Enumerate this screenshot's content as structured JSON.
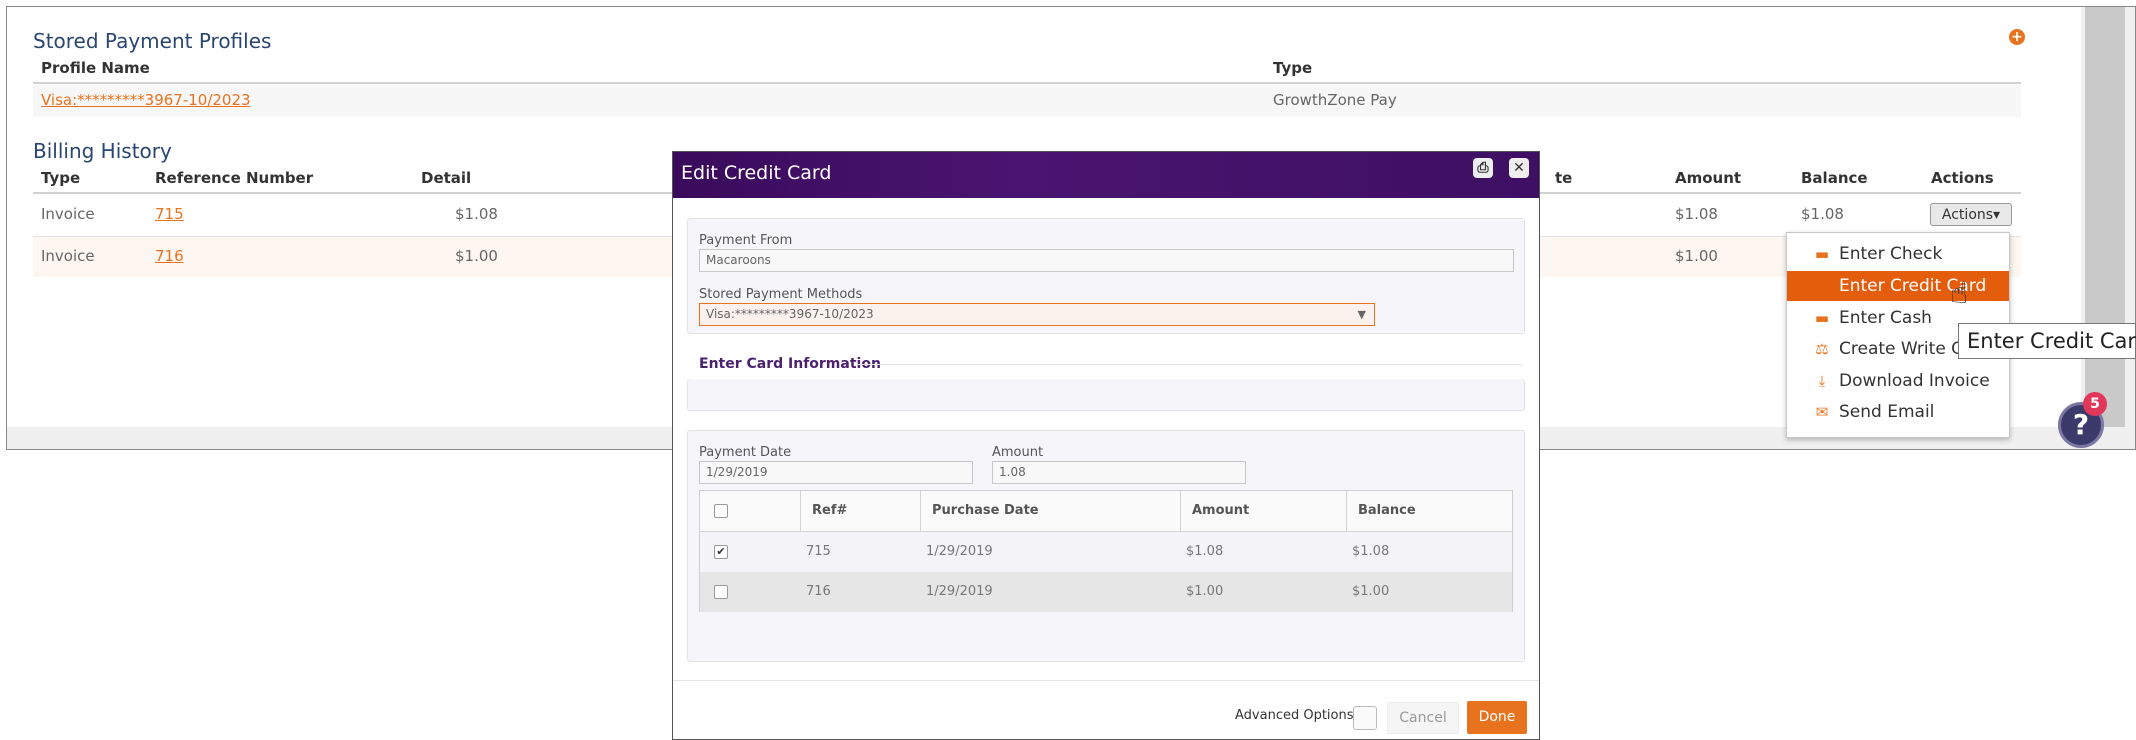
{
  "stored_profiles": {
    "title": "Stored Payment Profiles",
    "col_profile_name": "Profile Name",
    "col_type": "Type",
    "row": {
      "profile": "Visa:*********3967-10/2023",
      "type": "GrowthZone Pay"
    }
  },
  "billing": {
    "title": "Billing History",
    "columns": {
      "type": "Type",
      "ref": "Reference Number",
      "detail": "Detail",
      "date_tail": "te",
      "amount": "Amount",
      "balance": "Balance",
      "actions": "Actions"
    },
    "rows": [
      {
        "type": "Invoice",
        "ref": "715",
        "detail": "$1.08",
        "amount": "$1.08",
        "balance": "$1.08"
      },
      {
        "type": "Invoice",
        "ref": "716",
        "detail": "$1.00",
        "amount": "$1.00",
        "balance": ""
      }
    ],
    "actions_button": "Actions▾"
  },
  "actions_menu": {
    "items": [
      {
        "label": "Enter Check",
        "icon": "money-icon",
        "glyph": "▬"
      },
      {
        "label": "Enter Credit Card",
        "icon": "",
        "glyph": ""
      },
      {
        "label": "Enter Cash",
        "icon": "money-icon",
        "glyph": "▬"
      },
      {
        "label": "Create Write O",
        "icon": "balance-scale-icon",
        "glyph": "⚖"
      },
      {
        "label": "Download Invoice",
        "icon": "download-icon",
        "glyph": "⤓"
      },
      {
        "label": "Send Email",
        "icon": "envelope-icon",
        "glyph": "✉"
      }
    ],
    "active_index": 1
  },
  "tooltip": "Enter Credit Card",
  "help_badge": "5",
  "help_glyph": "?",
  "modal": {
    "title": "Edit Credit Card",
    "payment_from_label": "Payment From",
    "payment_from_value": "Macaroons",
    "stored_methods_label": "Stored Payment Methods",
    "stored_methods_value": "Visa:*********3967-10/2023",
    "enter_card_section": "Enter Card Information",
    "payment_date_label": "Payment Date",
    "payment_date_value": "1/29/2019",
    "amount_label": "Amount",
    "amount_value": "1.08",
    "table": {
      "headers": {
        "ref": "Ref#",
        "purchase_date": "Purchase Date",
        "amount": "Amount",
        "balance": "Balance"
      },
      "rows": [
        {
          "checked": true,
          "ref": "715",
          "purchase_date": "1/29/2019",
          "amount": "$1.08",
          "balance": "$1.08"
        },
        {
          "checked": false,
          "ref": "716",
          "purchase_date": "1/29/2019",
          "amount": "$1.00",
          "balance": "$1.00"
        }
      ]
    },
    "advanced_options_label": "Advanced Options",
    "cancel_label": "Cancel",
    "done_label": "Done"
  },
  "colors": {
    "accent": "#e8731f",
    "header_purple": "#3a0a5c",
    "menu_active": "#e35d0d",
    "title_blue": "#2a4670"
  }
}
